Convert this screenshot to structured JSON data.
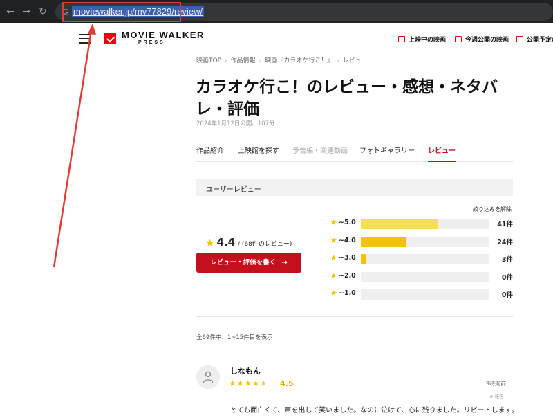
{
  "browser": {
    "back_icon": "arrow-left-icon",
    "forward_icon": "arrow-right-icon",
    "reload_icon": "reload-icon",
    "url": "moviewalker.jp/mv77829/review/"
  },
  "header": {
    "logo_title": "MOVIE WALKER",
    "logo_subtitle": "PRESS",
    "nav": [
      {
        "label": "上映中の映画"
      },
      {
        "label": "今週公開の映画"
      },
      {
        "label": "公開予定の"
      }
    ]
  },
  "breadcrumb": [
    "映画TOP",
    "作品情報",
    "映画『カラオケ行こ！』",
    "レビュー"
  ],
  "page": {
    "title": "カラオケ行こ！のレビュー・感想・ネタバレ・評価",
    "release_info": "2024年1月12日公開、107分"
  },
  "tabs": [
    {
      "label": "作品紹介",
      "state": "normal"
    },
    {
      "label": "上映館を探す",
      "state": "normal"
    },
    {
      "label": "予告編・関連動画",
      "state": "disabled"
    },
    {
      "label": "フォトギャラリー",
      "state": "normal"
    },
    {
      "label": "レビュー",
      "state": "active"
    }
  ],
  "user_reviews": {
    "heading": "ユーザーレビュー",
    "reset_filter": "絞り込みを解除",
    "average": "4.4",
    "count_label": "/ (68件のレビュー)",
    "write_button": "レビュー・評価を書く",
    "distribution": [
      {
        "label": "~5.0",
        "count": "41件",
        "fraction": 0.6
      },
      {
        "label": "~4.0",
        "count": "24件",
        "fraction": 0.35
      },
      {
        "label": "~3.0",
        "count": "3件",
        "fraction": 0.045
      },
      {
        "label": "~2.0",
        "count": "0件",
        "fraction": 0
      },
      {
        "label": "~1.0",
        "count": "0件",
        "fraction": 0
      }
    ],
    "results_info": "全69件中、1~15件目を表示"
  },
  "review": {
    "name": "しなもん",
    "rating": "4.5",
    "time": "9時間前",
    "report": "⊘ 報告",
    "body": "とても面白くて、声を出して笑いました。なのに泣けて、心に残りました。リピートします。"
  },
  "colors": {
    "brand_red": "#c4101d",
    "star_yellow": "#f2c300",
    "bar_5": "#f7de5a",
    "bar_4": "#f2c300",
    "bar_3": "#f2c300",
    "annotation_red": "#e53935"
  }
}
